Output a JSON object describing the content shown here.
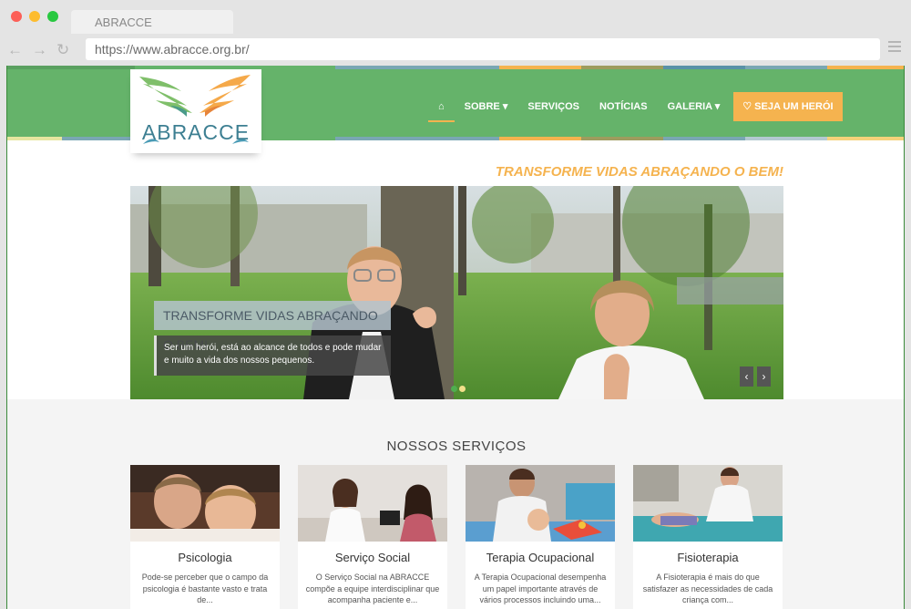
{
  "browser": {
    "tab_title": "ABRACCE",
    "url": "https://www.abracce.org.br/",
    "back_icon": "←",
    "forward_icon": "→",
    "reload_icon": "↻"
  },
  "header": {
    "logo_text": "ABRACCE",
    "nav": {
      "home_icon": "⌂",
      "sobre": "SOBRE ▾",
      "servicos": "SERVIÇOS",
      "noticias": "NOTÍCIAS",
      "galeria": "GALERIA ▾",
      "cta": "♡ SEJA UM HERÓI"
    },
    "colors": {
      "green": "#65b36a",
      "accent": "#f5b34f"
    }
  },
  "tagline": "TRANSFORME VIDAS ABRAÇANDO O BEM!",
  "slider": {
    "caption_title": "TRANSFORME VIDAS ABRAÇANDO O BEM!",
    "caption_text": "Ser um herói, está ao alcance de todos e pode mudar e muito a vida dos nossos pequenos.",
    "prev": "‹",
    "next": "›"
  },
  "services": {
    "title": "NOSSOS SERVIÇOS",
    "cards": [
      {
        "title": "Psicologia",
        "text": "Pode-se perceber que o campo da psicologia é bastante vasto e trata de..."
      },
      {
        "title": "Serviço Social",
        "text": "O Serviço Social na ABRACCE compõe a equipe interdisciplinar que acompanha paciente e..."
      },
      {
        "title": "Terapia Ocupacional",
        "text": "A Terapia Ocupacional desempenha um papel importante através de vários processos incluindo uma..."
      },
      {
        "title": "Fisioterapia",
        "text": "A Fisioterapia é mais do que satisfazer as necessidades de cada criança com..."
      }
    ]
  }
}
